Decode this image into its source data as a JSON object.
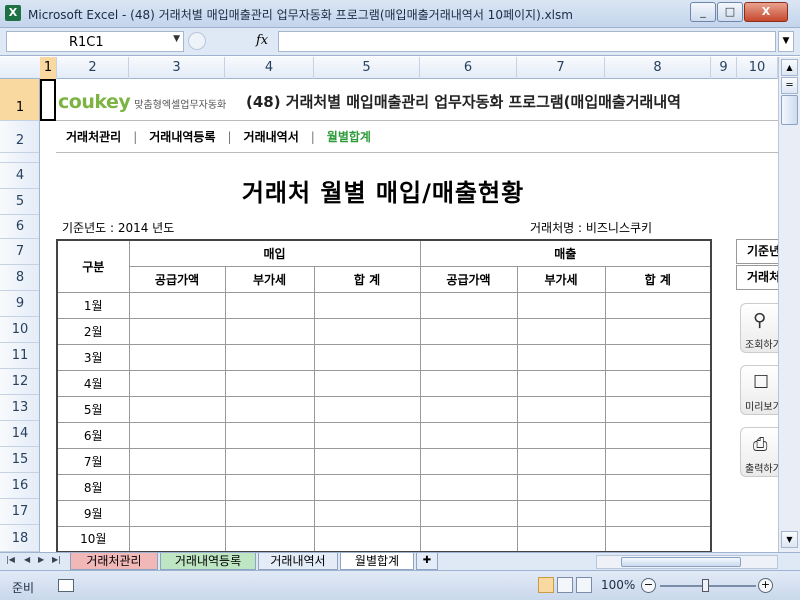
{
  "window": {
    "title": "Microsoft Excel - (48) 거래처별 매입매출관리 업무자동화 프로그램(매입매출거래내역서 10페이지).xlsm",
    "minimize": "_",
    "maximize": "□",
    "close": "X"
  },
  "formula_bar": {
    "name_box": "R1C1",
    "fx_label": "fx",
    "formula": ""
  },
  "columns": [
    "1",
    "2",
    "3",
    "4",
    "5",
    "6",
    "7",
    "8",
    "9",
    "10"
  ],
  "rows": [
    "1",
    "2",
    "3",
    "4",
    "5",
    "6",
    "7",
    "8",
    "9",
    "10",
    "11",
    "12",
    "13",
    "14",
    "15",
    "16",
    "17",
    "18"
  ],
  "sheet": {
    "logo_brand": "coukey",
    "logo_tag": "맞춤형엑셀업무자동화",
    "doc_title": "(48) 거래처별 매입매출관리 업무자동화 프로그램(매입매출거래내역",
    "nav": {
      "partner_mgmt": "거래처관리",
      "txn_register": "거래내역등록",
      "txn_statement": "거래내역서",
      "monthly_total": "월별합계"
    },
    "report_title": "거래처 월별 매입/매출현황",
    "year_label": "기준년도 :  2014  년도",
    "partner_label": "거래처명 :     비즈니스쿠키",
    "table": {
      "col_group": "구분",
      "purchase": "매입",
      "sales": "매출",
      "supply_amount": "공급가액",
      "vat": "부가세",
      "total": "합 계",
      "months": [
        "1월",
        "2월",
        "3월",
        "4월",
        "5월",
        "6월",
        "7월",
        "8월",
        "9월",
        "10월"
      ]
    },
    "side": {
      "year_box": "기준년",
      "partner_box": "거래처",
      "search_btn": "조회하기",
      "preview_btn": "미리보기",
      "print_btn": "출력하기"
    }
  },
  "sheet_tabs": [
    "거래처관리",
    "거래내역등록",
    "거래내역서",
    "월별합계"
  ],
  "status": {
    "ready": "준비",
    "zoom": "100%",
    "zoom_out": "−",
    "zoom_in": "+"
  }
}
